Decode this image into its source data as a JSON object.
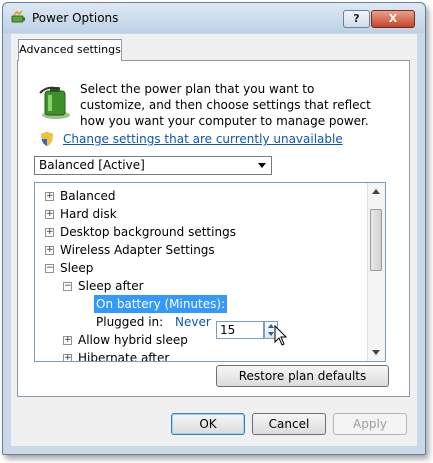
{
  "window": {
    "title": "Power Options",
    "help_label": "?",
    "close_label": "X"
  },
  "tab": {
    "label": "Advanced settings"
  },
  "intro": {
    "text": "Select the power plan that you want to customize, and then choose settings that reflect how you want your computer to manage power.",
    "change_link": "Change settings that are currently unavailable"
  },
  "plan_select": {
    "value": "Balanced [Active]"
  },
  "tree": {
    "items": [
      {
        "label": "Balanced",
        "expander": "+"
      },
      {
        "label": "Hard disk",
        "expander": "+"
      },
      {
        "label": "Desktop background settings",
        "expander": "+"
      },
      {
        "label": "Wireless Adapter Settings",
        "expander": "+"
      },
      {
        "label": "Sleep",
        "expander": "−"
      },
      {
        "label": "Sleep after",
        "expander": "−"
      },
      {
        "label": "On battery (Minutes):",
        "value": "15"
      },
      {
        "label": "Plugged in:",
        "value": "Never"
      },
      {
        "label": "Allow hybrid sleep",
        "expander": "+"
      },
      {
        "label": "Hibernate after",
        "expander": "+"
      }
    ]
  },
  "buttons": {
    "restore": "Restore plan defaults",
    "ok": "OK",
    "cancel": "Cancel",
    "apply": "Apply"
  },
  "colors": {
    "link": "#0b55b8",
    "selection": "#3399ff",
    "close_button": "#c4442b"
  },
  "icons": [
    "app-power-icon",
    "battery-icon",
    "shield-icon",
    "cursor-icon"
  ]
}
